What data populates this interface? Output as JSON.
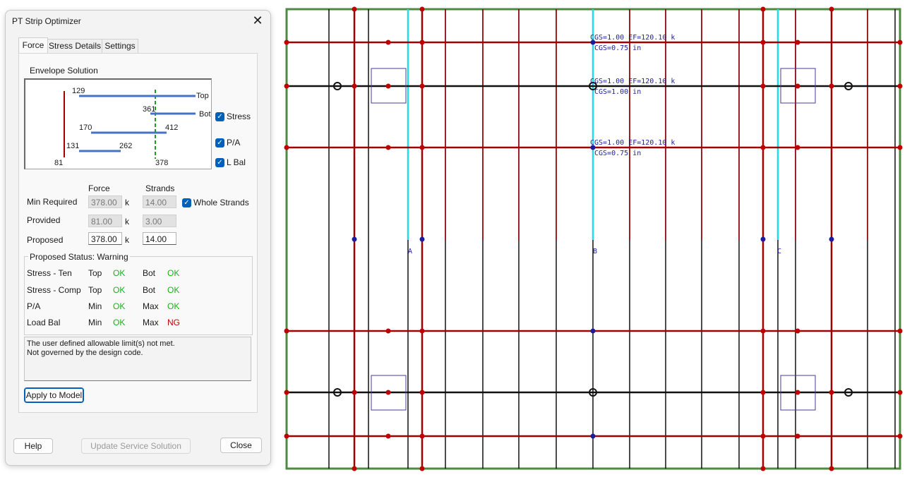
{
  "dialog": {
    "title": "PT Strip Optimizer",
    "tabs": [
      {
        "label": "Force",
        "active": true
      },
      {
        "label": "Stress Details",
        "active": false
      },
      {
        "label": "Settings",
        "active": false
      }
    ],
    "envelope": {
      "title": "Envelope Solution",
      "labels": {
        "v129": "129",
        "top": "Top",
        "v361": "361",
        "bot": "Bot",
        "v170": "170",
        "v412": "412",
        "v131": "131",
        "v262": "262",
        "v81": "81",
        "v378": "378"
      },
      "checks": [
        {
          "label": "Stress",
          "checked": true
        },
        {
          "label": "P/A",
          "checked": true
        },
        {
          "label": "L Bal",
          "checked": true
        }
      ]
    },
    "force_table": {
      "col_force": "Force",
      "col_strands": "Strands",
      "rows": [
        {
          "label": "Min Required",
          "force": "378.00",
          "unit": "k",
          "strands": "14.00",
          "editable": false
        },
        {
          "label": "Provided",
          "force": "81.00",
          "unit": "k",
          "strands": "3.00",
          "editable": false
        },
        {
          "label": "Proposed",
          "force": "378.00",
          "unit": "k",
          "strands": "14.00",
          "editable": true
        }
      ],
      "whole_strands": {
        "label": "Whole Strands",
        "checked": true
      }
    },
    "status": {
      "title": "Proposed Status: Warning",
      "rows": [
        {
          "label": "Stress - Ten",
          "a": "Top",
          "a_val": "OK",
          "b": "Bot",
          "b_val": "OK"
        },
        {
          "label": "Stress - Comp",
          "a": "Top",
          "a_val": "OK",
          "b": "Bot",
          "b_val": "OK"
        },
        {
          "label": "P/A",
          "a": "Min",
          "a_val": "OK",
          "b": "Max",
          "b_val": "OK"
        },
        {
          "label": "Load Bal",
          "a": "Min",
          "a_val": "OK",
          "b": "Max",
          "b_val": "NG"
        }
      ]
    },
    "message_lines": [
      "The user defined allowable limit(s) not met.",
      "Not governed by the design code."
    ],
    "apply_label": "Apply to Model",
    "help_label": "Help",
    "update_label": "Update Service Solution",
    "close_label": "Close"
  },
  "drawing": {
    "grid_labels": [
      "A",
      "B",
      "C"
    ],
    "annotations": [
      {
        "line1": "CGS=1.00   EF=120.10 k",
        "line2": "CGS=0.75 in"
      },
      {
        "line1": "CGS=1.00   EF=120.10 k",
        "line2": "CGS=1.00 in"
      },
      {
        "line1": "CGS=1.00   EF=120.10 k",
        "line2": "CGS=0.75 in"
      }
    ],
    "colors": {
      "green": "#4d8a3f",
      "red": "#a00000",
      "black": "#111111",
      "cyan": "#22dde8",
      "blue": "#1c1c9c",
      "purple": "#4b3a9e"
    }
  }
}
